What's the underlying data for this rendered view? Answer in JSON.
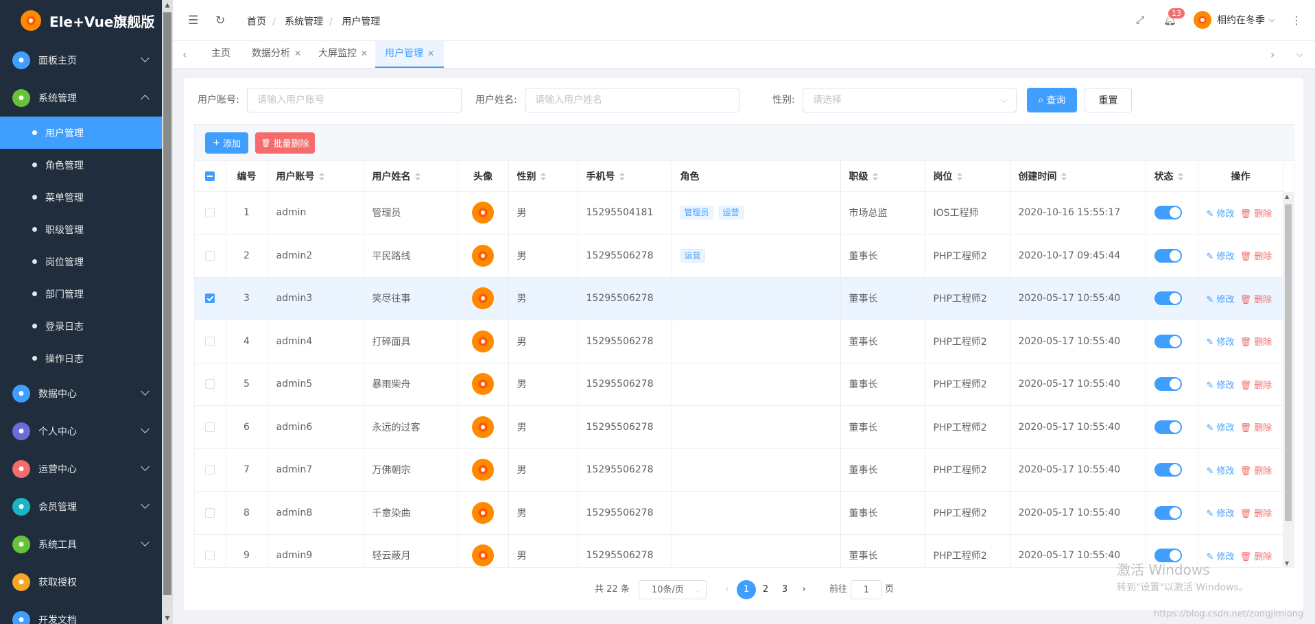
{
  "app": {
    "title": "Ele+Vue旗舰版"
  },
  "sidebar": {
    "groups": [
      {
        "label": "面板主页",
        "color": "#409eff",
        "icon": "home-icon"
      },
      {
        "label": "系统管理",
        "color": "#67c23a",
        "icon": "gear-icon"
      },
      {
        "label": "数据中心",
        "color": "#409eff",
        "icon": "database-icon"
      },
      {
        "label": "个人中心",
        "color": "#6c6cd9",
        "icon": "user-icon"
      },
      {
        "label": "运营中心",
        "color": "#f56c6c",
        "icon": "operations-icon"
      },
      {
        "label": "会员管理",
        "color": "#1bb6c6",
        "icon": "member-icon"
      },
      {
        "label": "系统工具",
        "color": "#67c23a",
        "icon": "tools-icon"
      },
      {
        "label": "获取授权",
        "color": "#f5a623",
        "icon": "license-icon"
      },
      {
        "label": "开发文档",
        "color": "#409eff",
        "icon": "docs-icon"
      }
    ],
    "sub_items": [
      "用户管理",
      "角色管理",
      "菜单管理",
      "职级管理",
      "岗位管理",
      "部门管理",
      "登录日志",
      "操作日志"
    ]
  },
  "header": {
    "breadcrumb": [
      "首页",
      "系统管理",
      "用户管理"
    ],
    "notification_count": "13",
    "username": "相约在冬季"
  },
  "tabs": [
    "主页",
    "数据分析",
    "大屏监控",
    "用户管理"
  ],
  "filters": {
    "account_label": "用户账号:",
    "account_placeholder": "请输入用户账号",
    "name_label": "用户姓名:",
    "name_placeholder": "请输入用户姓名",
    "gender_label": "性别:",
    "gender_placeholder": "请选择",
    "search_label": "查询",
    "reset_label": "重置"
  },
  "toolbar": {
    "add_label": "添加",
    "batch_delete_label": "批量删除"
  },
  "table": {
    "columns": [
      "编号",
      "用户账号",
      "用户姓名",
      "头像",
      "性别",
      "手机号",
      "角色",
      "职级",
      "岗位",
      "创建时间",
      "状态",
      "操作"
    ],
    "edit_label": "修改",
    "delete_label": "删除",
    "rows": [
      {
        "id": "1",
        "account": "admin",
        "name": "管理员",
        "gender": "男",
        "phone": "15295504181",
        "roles": [
          "管理员",
          "运营"
        ],
        "level": "市场总监",
        "post": "IOS工程师",
        "created": "2020-10-16 15:55:17",
        "selected": false
      },
      {
        "id": "2",
        "account": "admin2",
        "name": "平民路线",
        "gender": "男",
        "phone": "15295506278",
        "roles": [
          "运营"
        ],
        "level": "董事长",
        "post": "PHP工程师2",
        "created": "2020-10-17 09:45:44",
        "selected": false
      },
      {
        "id": "3",
        "account": "admin3",
        "name": "笑尽往事",
        "gender": "男",
        "phone": "15295506278",
        "roles": [],
        "level": "董事长",
        "post": "PHP工程师2",
        "created": "2020-05-17 10:55:40",
        "selected": true
      },
      {
        "id": "4",
        "account": "admin4",
        "name": "打碎面具",
        "gender": "男",
        "phone": "15295506278",
        "roles": [],
        "level": "董事长",
        "post": "PHP工程师2",
        "created": "2020-05-17 10:55:40",
        "selected": false
      },
      {
        "id": "5",
        "account": "admin5",
        "name": "暴雨柴舟",
        "gender": "男",
        "phone": "15295506278",
        "roles": [],
        "level": "董事长",
        "post": "PHP工程师2",
        "created": "2020-05-17 10:55:40",
        "selected": false
      },
      {
        "id": "6",
        "account": "admin6",
        "name": "永远的过客",
        "gender": "男",
        "phone": "15295506278",
        "roles": [],
        "level": "董事长",
        "post": "PHP工程师2",
        "created": "2020-05-17 10:55:40",
        "selected": false
      },
      {
        "id": "7",
        "account": "admin7",
        "name": "万佛朝宗",
        "gender": "男",
        "phone": "15295506278",
        "roles": [],
        "level": "董事长",
        "post": "PHP工程师2",
        "created": "2020-05-17 10:55:40",
        "selected": false
      },
      {
        "id": "8",
        "account": "admin8",
        "name": "千意染曲",
        "gender": "男",
        "phone": "15295506278",
        "roles": [],
        "level": "董事长",
        "post": "PHP工程师2",
        "created": "2020-05-17 10:55:40",
        "selected": false
      },
      {
        "id": "9",
        "account": "admin9",
        "name": "轻云蔽月",
        "gender": "男",
        "phone": "15295506278",
        "roles": [],
        "level": "董事长",
        "post": "PHP工程师2",
        "created": "2020-05-17 10:55:40",
        "selected": false
      }
    ]
  },
  "pagination": {
    "total": "共 22 条",
    "page_size": "10条/页",
    "pages": [
      "1",
      "2",
      "3"
    ],
    "current_page": "1",
    "goto_prefix": "前往",
    "goto_value": "1",
    "goto_suffix": "页"
  },
  "watermark": {
    "line1": "激活 Windows",
    "line2": "转到\"设置\"以激活 Windows。",
    "line3": "https://blog.csdn.net/zongjimiong"
  }
}
